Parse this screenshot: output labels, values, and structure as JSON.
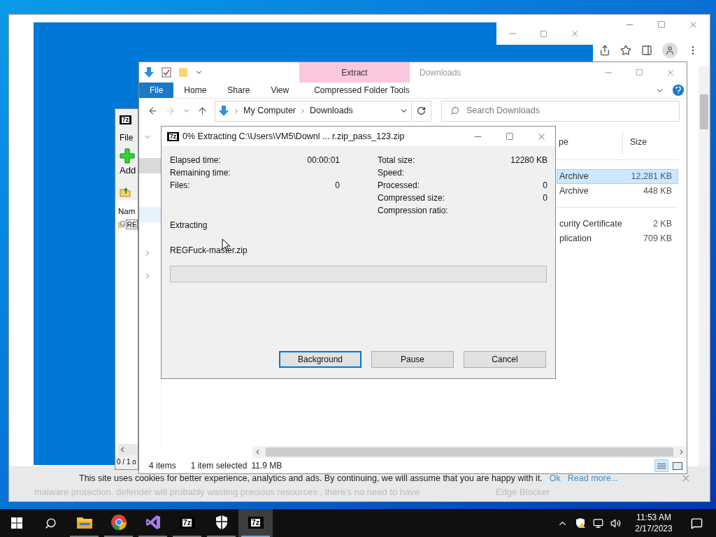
{
  "browser": {
    "article_line": "malware protection. defender will probably wasting precious resources , there's no need to have",
    "side_link": "Edge Blocker",
    "cookie_banner": {
      "text": "This site uses cookies for better experience, analytics and ads. By continuing, we will assume that you are happy with it.",
      "ok": "Ok",
      "read_more": "Read more..."
    }
  },
  "archive_manager": {
    "logo_text": "7z",
    "menu": [
      "File"
    ],
    "tools": [
      "Add"
    ],
    "column": "Nam",
    "row": "RE",
    "status": "0 / 1 o"
  },
  "explorer": {
    "title": "Downloads",
    "context_label": "Extract",
    "ribbon_tabs": [
      {
        "label": "File",
        "kind": "file"
      },
      {
        "label": "Home",
        "kind": "tab"
      },
      {
        "label": "Share",
        "kind": "tab"
      },
      {
        "label": "View",
        "kind": "tab"
      },
      {
        "label": "Compressed Folder Tools",
        "kind": "context"
      }
    ],
    "path": [
      "My Computer",
      "Downloads"
    ],
    "search_placeholder": "Search Downloads",
    "columns": [
      "pe",
      "Size"
    ],
    "groups": [
      [
        {
          "type": "Archive",
          "size": "12,281 KB",
          "selected": true
        },
        {
          "type": "Archive",
          "size": "448 KB",
          "selected": false
        }
      ],
      [
        {
          "type": "curity Certificate",
          "size": "2 KB",
          "selected": false
        },
        {
          "type": "plication",
          "size": "709 KB",
          "selected": false
        }
      ]
    ],
    "status": {
      "items": "4 items",
      "selection": "1 item selected",
      "size": "11.9 MB"
    }
  },
  "dialog": {
    "logo_text": "7z",
    "title": "0% Extracting C:\\Users\\VM5\\Downl ... r.zip_pass_123.zip",
    "left_stats": [
      {
        "label": "Elapsed time:",
        "value": "00:00:01"
      },
      {
        "label": "Remaining time:"
      },
      {
        "label": "Files:",
        "value": "0"
      }
    ],
    "right_stats": [
      {
        "label": "Total size:",
        "value": "12280 KB"
      },
      {
        "label": "Speed:"
      },
      {
        "label": "Processed:",
        "value": "0"
      },
      {
        "label": "Compressed size:",
        "value": "0"
      },
      {
        "label": "Compression ratio:"
      }
    ],
    "status": "Extracting",
    "file": "REGFuck-master.zip",
    "progress": {
      "level": 0
    },
    "buttons": [
      {
        "label": "Background",
        "default": true
      },
      {
        "label": "Pause",
        "default": false
      },
      {
        "label": "Cancel",
        "default": false
      }
    ]
  },
  "taskbar": {
    "apps": [
      {
        "kind": "explorer",
        "selected": false
      },
      {
        "kind": "chrome",
        "selected": false
      },
      {
        "kind": "studio",
        "selected": false
      },
      {
        "kind": "archiver",
        "text": "7z",
        "selected": false
      },
      {
        "kind": "shield",
        "selected": false
      },
      {
        "kind": "archiver",
        "text": "7z",
        "selected": true
      }
    ],
    "time": "11:53 AM",
    "date": "2/17/2023"
  }
}
